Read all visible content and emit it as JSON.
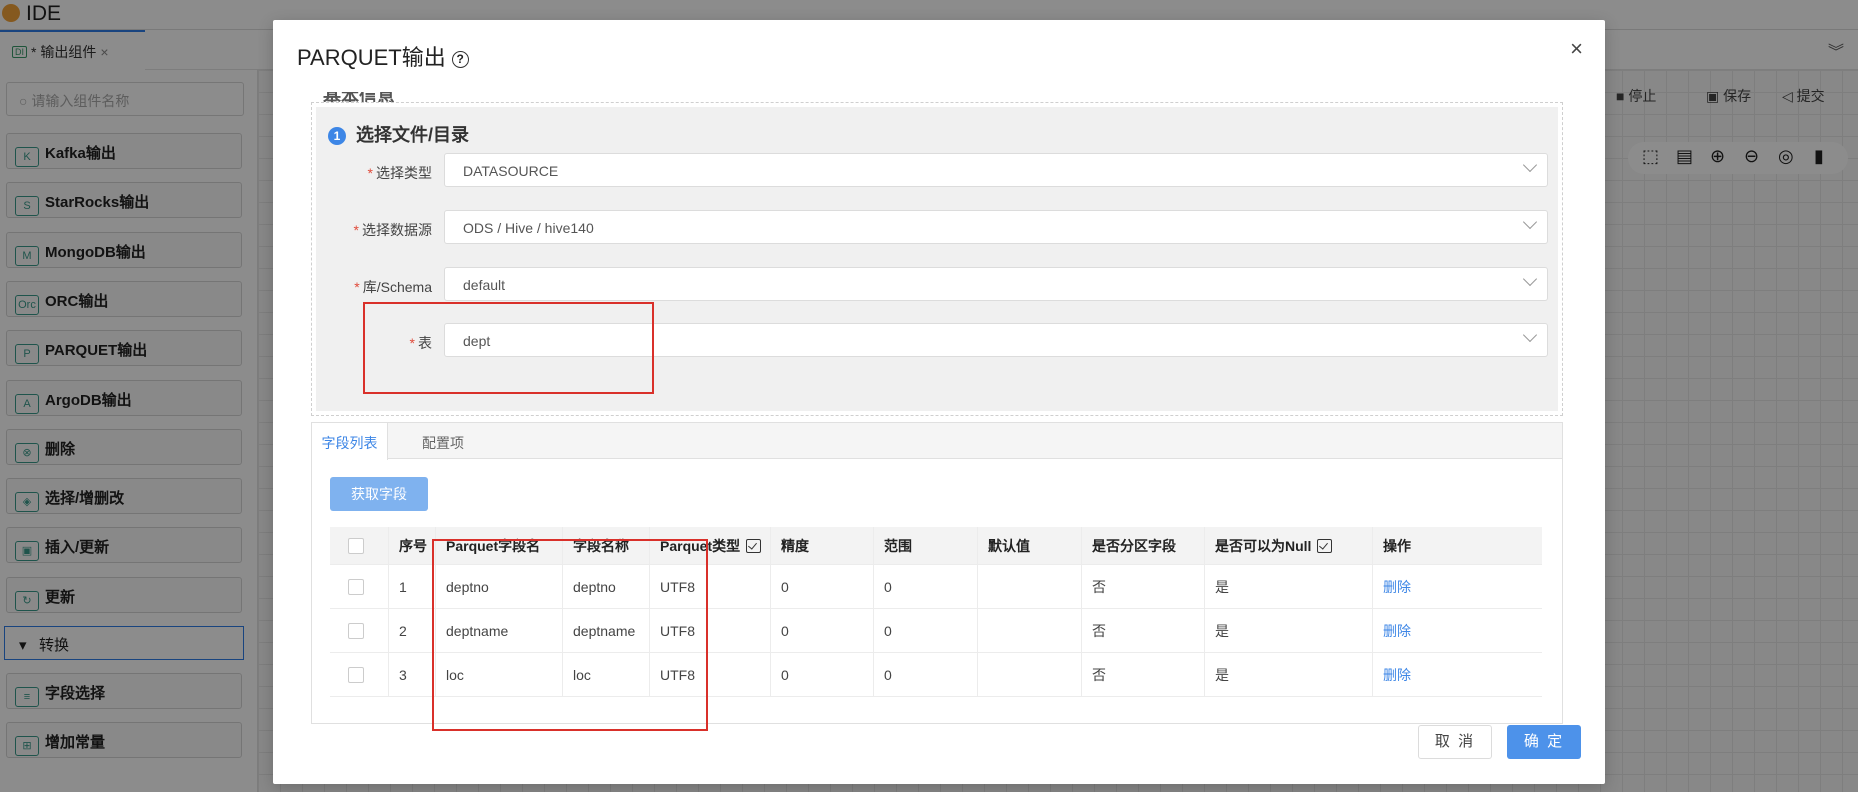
{
  "ide": {
    "title": "IDE",
    "tab_label": "* 输出组件",
    "tab_badge": "DI",
    "search_placeholder": "请输入组件名称",
    "sidebar_items": [
      "Kafka输出",
      "StarRocks输出",
      "MongoDB输出",
      "ORC输出",
      "PARQUET输出",
      "ArgoDB输出",
      "删除",
      "选择/增删改",
      "插入/更新",
      "更新"
    ],
    "sidebar_icons": [
      "K",
      "S",
      "M",
      "Orc",
      "P",
      "A",
      "⊗",
      "◈",
      "▣",
      "↻"
    ],
    "group_label": "转换",
    "sidebar_items_after": [
      "字段选择",
      "增加常量"
    ],
    "sidebar_icons_after": [
      "≡",
      "⊞"
    ],
    "toolbar": {
      "stop": "停止",
      "save": "保存",
      "submit": "提交"
    }
  },
  "modal": {
    "title": "PARQUET输出",
    "section_title": "选择文件/目录",
    "step_number": "1",
    "fields": [
      {
        "label": "选择类型",
        "value": "DATASOURCE"
      },
      {
        "label": "选择数据源",
        "value": "ODS / Hive / hive140"
      },
      {
        "label": "库/Schema",
        "value": "default"
      },
      {
        "label": "表",
        "value": "dept"
      }
    ],
    "tabs": [
      "字段列表",
      "配置项"
    ],
    "fetch_button": "获取字段",
    "table": {
      "headers": [
        "序号",
        "Parquet字段名",
        "字段名称",
        "Parquet类型",
        "精度",
        "范围",
        "默认值",
        "是否分区字段",
        "是否可以为Null",
        "操作"
      ],
      "rows": [
        [
          "1",
          "deptno",
          "deptno",
          "UTF8",
          "0",
          "0",
          "",
          "否",
          "是",
          "删除"
        ],
        [
          "2",
          "deptname",
          "deptname",
          "UTF8",
          "0",
          "0",
          "",
          "否",
          "是",
          "删除"
        ],
        [
          "3",
          "loc",
          "loc",
          "UTF8",
          "0",
          "0",
          "",
          "否",
          "是",
          "删除"
        ]
      ]
    },
    "cancel": "取 消",
    "ok": "确 定"
  }
}
